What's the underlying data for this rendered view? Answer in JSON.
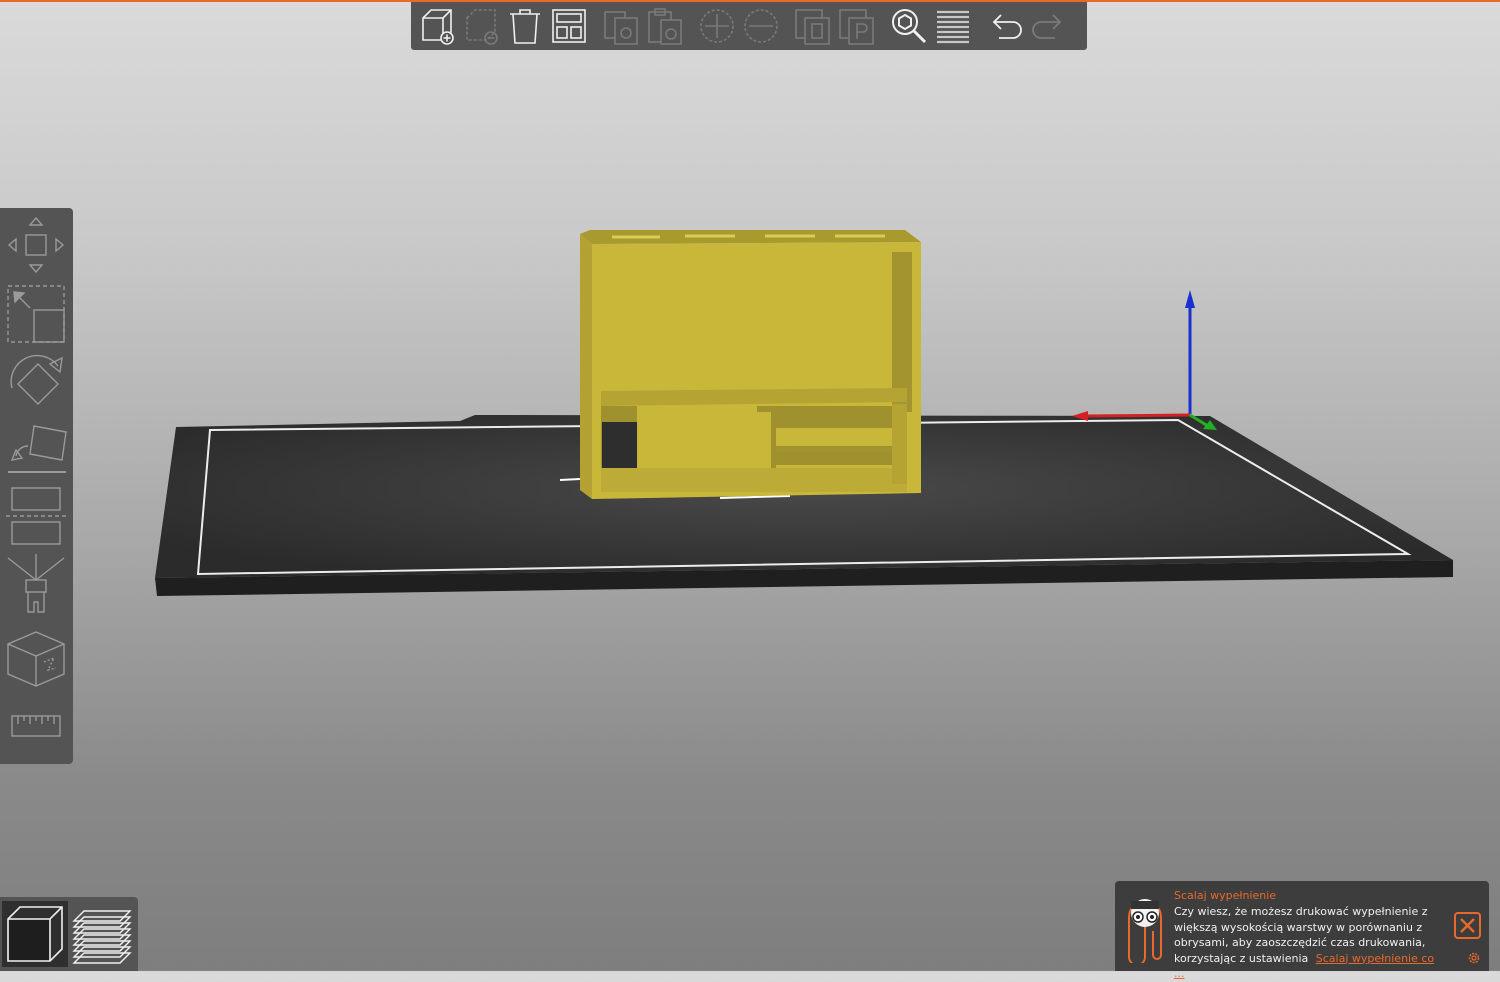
{
  "colors": {
    "accent": "#e8692d",
    "panel": "#545454",
    "model": "#c9b73a",
    "bed": "#2e2e2e",
    "axis_x": "#d32020",
    "axis_y": "#22b022",
    "axis_z": "#1a2fd0"
  },
  "top_toolbar": {
    "buttons": [
      {
        "icon": "add-object-icon",
        "enabled": true
      },
      {
        "icon": "delete-object-icon",
        "enabled": false
      },
      {
        "icon": "delete-all-icon",
        "enabled": true
      },
      {
        "icon": "arrange-icon",
        "enabled": true
      },
      {
        "icon": "copy-icon",
        "enabled": false
      },
      {
        "icon": "paste-icon",
        "enabled": false
      },
      {
        "icon": "add-instance-icon",
        "enabled": false
      },
      {
        "icon": "remove-instance-icon",
        "enabled": false
      },
      {
        "icon": "split-to-objects-icon",
        "enabled": false
      },
      {
        "icon": "split-to-parts-icon",
        "enabled": false
      },
      {
        "icon": "search-icon",
        "enabled": true
      },
      {
        "icon": "layers-editing-icon",
        "enabled": true
      },
      {
        "icon": "undo-icon",
        "enabled": true
      },
      {
        "icon": "redo-icon",
        "enabled": false
      }
    ]
  },
  "left_toolbar": {
    "tools": [
      "move-icon",
      "scale-icon",
      "rotate-icon",
      "place-on-face-icon",
      "cut-icon",
      "paint-supports-icon",
      "seam-painting-icon",
      "measure-icon"
    ]
  },
  "view_switch": {
    "items": [
      {
        "icon": "3d-view-icon",
        "active": true
      },
      {
        "icon": "preview-icon",
        "active": false
      }
    ]
  },
  "hint": {
    "title": "Scalaj wypełnienie",
    "body": "Czy wiesz, że możesz drukować wypełnienie z większą wysokością warstwy w porównaniu z obrysami, aby zaoszczędzić czas drukowania, korzystając z ustawienia",
    "link": "Scalaj wypełnienie co ..."
  }
}
